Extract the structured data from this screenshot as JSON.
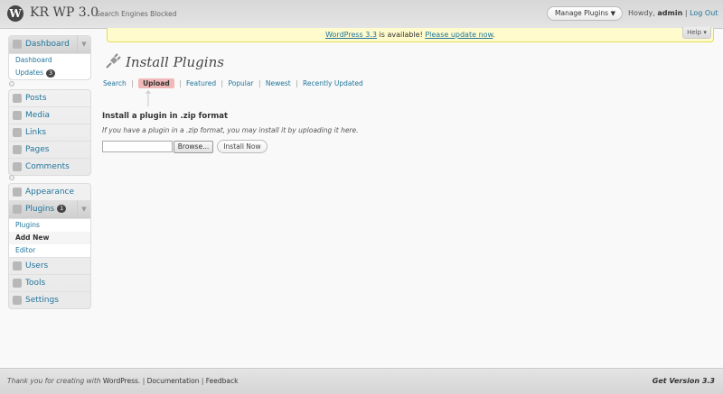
{
  "header": {
    "site_title": "KR WP 3.0",
    "privacy_status": "Search Engines Blocked",
    "favorite_actions": "Manage Plugins",
    "howdy": "Howdy,",
    "username": "admin",
    "separator": "|",
    "logout": "Log Out"
  },
  "update_nag": {
    "version_link": "WordPress 3.3",
    "middle_text": " is available! ",
    "update_link": "Please update now",
    "end": "."
  },
  "help_tab": "Help",
  "sidebar": {
    "dashboard": {
      "label": "Dashboard",
      "sub": [
        "Dashboard",
        "Updates"
      ],
      "updates_count": "3"
    },
    "group2": [
      "Posts",
      "Media",
      "Links",
      "Pages",
      "Comments"
    ],
    "appearance": "Appearance",
    "plugins": {
      "label": "Plugins",
      "count": "1",
      "sub": [
        "Plugins",
        "Add New",
        "Editor"
      ]
    },
    "group4": [
      "Users",
      "Tools",
      "Settings"
    ]
  },
  "main": {
    "page_title": "Install Plugins",
    "tabs": [
      "Search",
      "Upload",
      "Featured",
      "Popular",
      "Newest",
      "Recently Updated"
    ],
    "tab_sep": "|",
    "section_title": "Install a plugin in .zip format",
    "help_text": "If you have a plugin in a .zip format, you may install it by uploading it here.",
    "browse_label": "Browse...",
    "install_label": "Install Now"
  },
  "footer": {
    "thanks_text": "Thank you for creating with ",
    "wordpress_link": "WordPress",
    "dot_sep": ". | ",
    "documentation": "Documentation",
    "pipe": " | ",
    "feedback": "Feedback",
    "version": "Get Version 3.3"
  },
  "colors": {
    "link": "#21759b",
    "nag_bg": "#fffbcc",
    "nag_border": "#e6db55",
    "badge": "#464646"
  },
  "icons": [
    "wordpress-logo-icon",
    "dashboard-icon",
    "posts-icon",
    "media-icon",
    "links-icon",
    "pages-icon",
    "comments-icon",
    "appearance-icon",
    "plugins-icon",
    "users-icon",
    "tools-icon",
    "settings-icon",
    "plugin-plug-icon"
  ]
}
